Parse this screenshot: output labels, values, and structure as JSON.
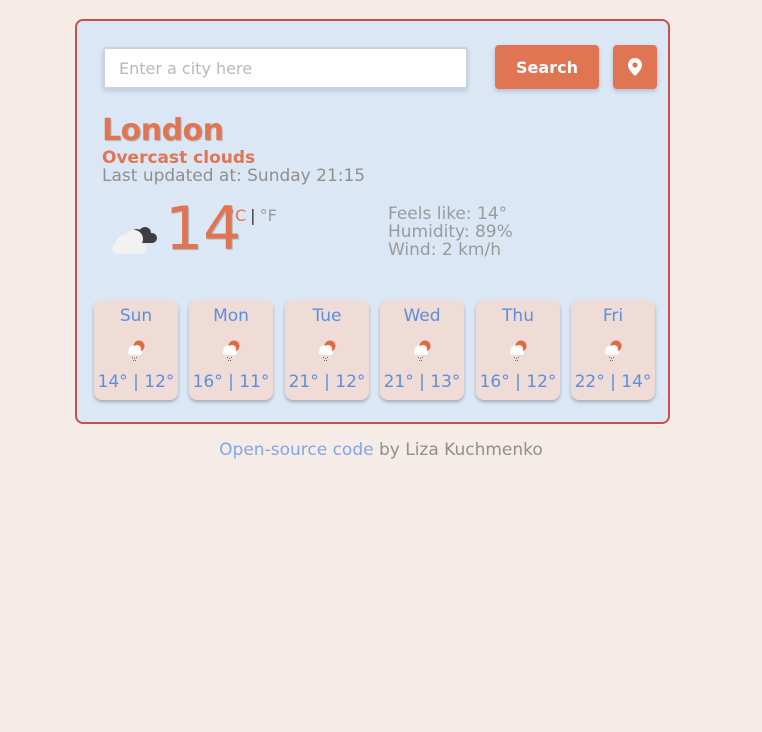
{
  "search": {
    "placeholder": "Enter a city here",
    "value": "",
    "button_label": "Search",
    "location_button_icon": "map-pin-icon"
  },
  "current": {
    "city": "London",
    "description": "Overcast clouds",
    "last_updated": "Last updated at: Sunday 21:15",
    "icon": "overcast-clouds-icon",
    "temperature": "14",
    "unit_celsius": "°C",
    "unit_separator": "|",
    "unit_fahrenheit": "°F",
    "feels_like": "Feels like: 14°",
    "humidity": "Humidity: 89%",
    "wind": "Wind: 2 km/h"
  },
  "forecast": [
    {
      "day": "Sun",
      "icon": "rain-sun-cloud-icon",
      "temps": "14° | 12°"
    },
    {
      "day": "Mon",
      "icon": "rain-sun-cloud-icon",
      "temps": "16° | 11°"
    },
    {
      "day": "Tue",
      "icon": "rain-sun-cloud-icon",
      "temps": "21° | 12°"
    },
    {
      "day": "Wed",
      "icon": "rain-sun-cloud-icon",
      "temps": "21° | 13°"
    },
    {
      "day": "Thu",
      "icon": "rain-sun-cloud-icon",
      "temps": "16° | 12°"
    },
    {
      "day": "Fri",
      "icon": "rain-sun-cloud-icon",
      "temps": "22° | 14°"
    }
  ],
  "footer": {
    "link_text": "Open-source code",
    "author_text": " by Liza Kuchmenko"
  },
  "colors": {
    "accent": "#df7552",
    "border": "#c9504a",
    "card_bg": "#dce7f5",
    "forecast_text": "#5b8ee0",
    "page_bg": "#f5ebe7"
  }
}
